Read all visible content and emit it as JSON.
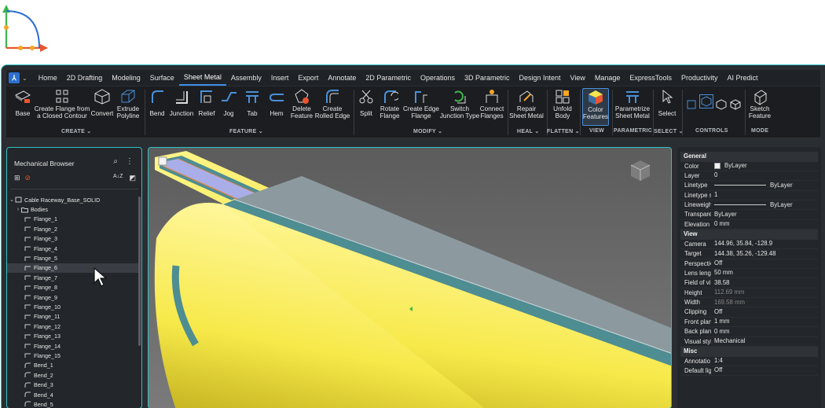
{
  "menu": {
    "items": [
      "Home",
      "2D Drafting",
      "Modeling",
      "Surface",
      "Sheet Metal",
      "Assembly",
      "Insert",
      "Export",
      "Annotate",
      "2D Parametric",
      "Operations",
      "3D Parametric",
      "Design Intent",
      "View",
      "Manage",
      "ExpressTools",
      "Productivity",
      "AI Predict"
    ],
    "active": "Sheet Metal"
  },
  "ribbon": {
    "base": "Base",
    "create_flange": "Create Flange from\na Closed Contour",
    "convert": "Convert",
    "extrude_polyline": "Extrude\nPolyline",
    "bend": "Bend",
    "junction": "Junction",
    "relief": "Relief",
    "jog": "Jog",
    "tab": "Tab",
    "hem": "Hem",
    "delete_feature": "Delete\nFeature",
    "create_rolled_edge": "Create\nRolled Edge",
    "split": "Split",
    "rotate_flange": "Rotate\nFlange",
    "create_edge_flange": "Create Edge\nFlange",
    "switch_junction_type": "Switch\nJunction Type",
    "connect_flanges": "Connect\nFlanges",
    "repair_sheet_metal": "Repair\nSheet Metal",
    "unfold_body": "Unfold\nBody",
    "color_features": "Color\nFeatures",
    "parametrize_sheet_metal": "Parametrize\nSheet Metal",
    "select": "Select",
    "sketch_feature": "Sketch\nFeature",
    "groups": {
      "create": "CREATE",
      "feature": "FEATURE",
      "modify": "MODIFY",
      "heal": "HEAL",
      "flatten": "FLATTEN",
      "view": "VIEW",
      "parametric": "PARAMETRIC",
      "select": "SELECT",
      "controls": "CONTROLS",
      "mode": "MODE"
    }
  },
  "browser": {
    "title": "Mechanical Browser",
    "root": "Cable Raceway_Base_SOLID",
    "bodies": "Bodies",
    "flanges": [
      "Flange_1",
      "Flange_2",
      "Flange_3",
      "Flange_4",
      "Flange_5",
      "Flange_6",
      "Flange_7",
      "Flange_8",
      "Flange_9",
      "Flange_10",
      "Flange_11",
      "Flange_12",
      "Flange_13",
      "Flange_14",
      "Flange_15"
    ],
    "bends": [
      "Bend_1",
      "Bend_2",
      "Bend_3",
      "Bend_4",
      "Bend_5"
    ],
    "highlighted": "Flange_6"
  },
  "properties": {
    "general": {
      "title": "General",
      "rows": [
        {
          "k": "Color",
          "v": "ByLayer"
        },
        {
          "k": "Layer",
          "v": "0"
        },
        {
          "k": "Linetype",
          "v": "ByLayer"
        },
        {
          "k": "Linetype s",
          "v": "1"
        },
        {
          "k": "Lineweigh",
          "v": "ByLayer"
        },
        {
          "k": "Transpare",
          "v": "ByLayer"
        },
        {
          "k": "Elevation",
          "v": "0 mm"
        }
      ]
    },
    "view": {
      "title": "View",
      "rows": [
        {
          "k": "Camera",
          "v": "144.96, 35.84, -128.9"
        },
        {
          "k": "Target",
          "v": "144.38, 35.26, -129.48"
        },
        {
          "k": "Perspectiv",
          "v": "Off"
        },
        {
          "k": "Lens lengt",
          "v": "50 mm"
        },
        {
          "k": "Field of vi",
          "v": "38.58"
        },
        {
          "k": "Height",
          "v": "112.69 mm"
        },
        {
          "k": "Width",
          "v": "169.58 mm"
        },
        {
          "k": "Clipping",
          "v": "Off"
        },
        {
          "k": "Front plan",
          "v": "1 mm"
        },
        {
          "k": "Back plane",
          "v": "0 mm"
        },
        {
          "k": "Visual styl",
          "v": "Mechanical"
        }
      ]
    },
    "misc": {
      "title": "Misc",
      "rows": [
        {
          "k": "Annotatio",
          "v": "1:4"
        },
        {
          "k": "Default lig",
          "v": "Off"
        }
      ]
    }
  },
  "colors": {
    "accent": "#2ec4c4",
    "yellow": "#f5e64a",
    "teal": "#4e8d92",
    "lavender": "#a9aee8",
    "orange": "#e8813a"
  }
}
